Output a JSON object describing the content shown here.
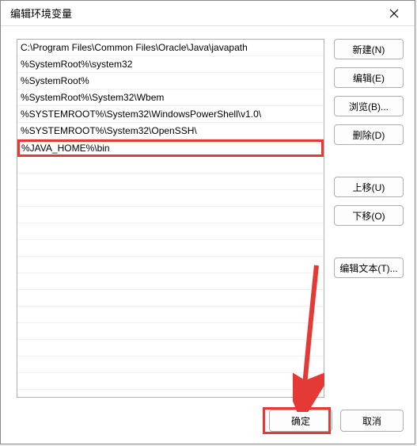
{
  "window": {
    "title": "编辑环境变量"
  },
  "list": {
    "items": [
      "C:\\Program Files\\Common Files\\Oracle\\Java\\javapath",
      "%SystemRoot%\\system32",
      "%SystemRoot%",
      "%SystemRoot%\\System32\\Wbem",
      "%SYSTEMROOT%\\System32\\WindowsPowerShell\\v1.0\\",
      "%SYSTEMROOT%\\System32\\OpenSSH\\",
      "%JAVA_HOME%\\bin"
    ],
    "highlight_index": 6
  },
  "buttons": {
    "new": "新建(N)",
    "edit": "编辑(E)",
    "browse": "浏览(B)...",
    "delete": "删除(D)",
    "move_up": "上移(U)",
    "move_down": "下移(O)",
    "edit_text": "编辑文本(T)...",
    "ok": "确定",
    "cancel": "取消"
  }
}
